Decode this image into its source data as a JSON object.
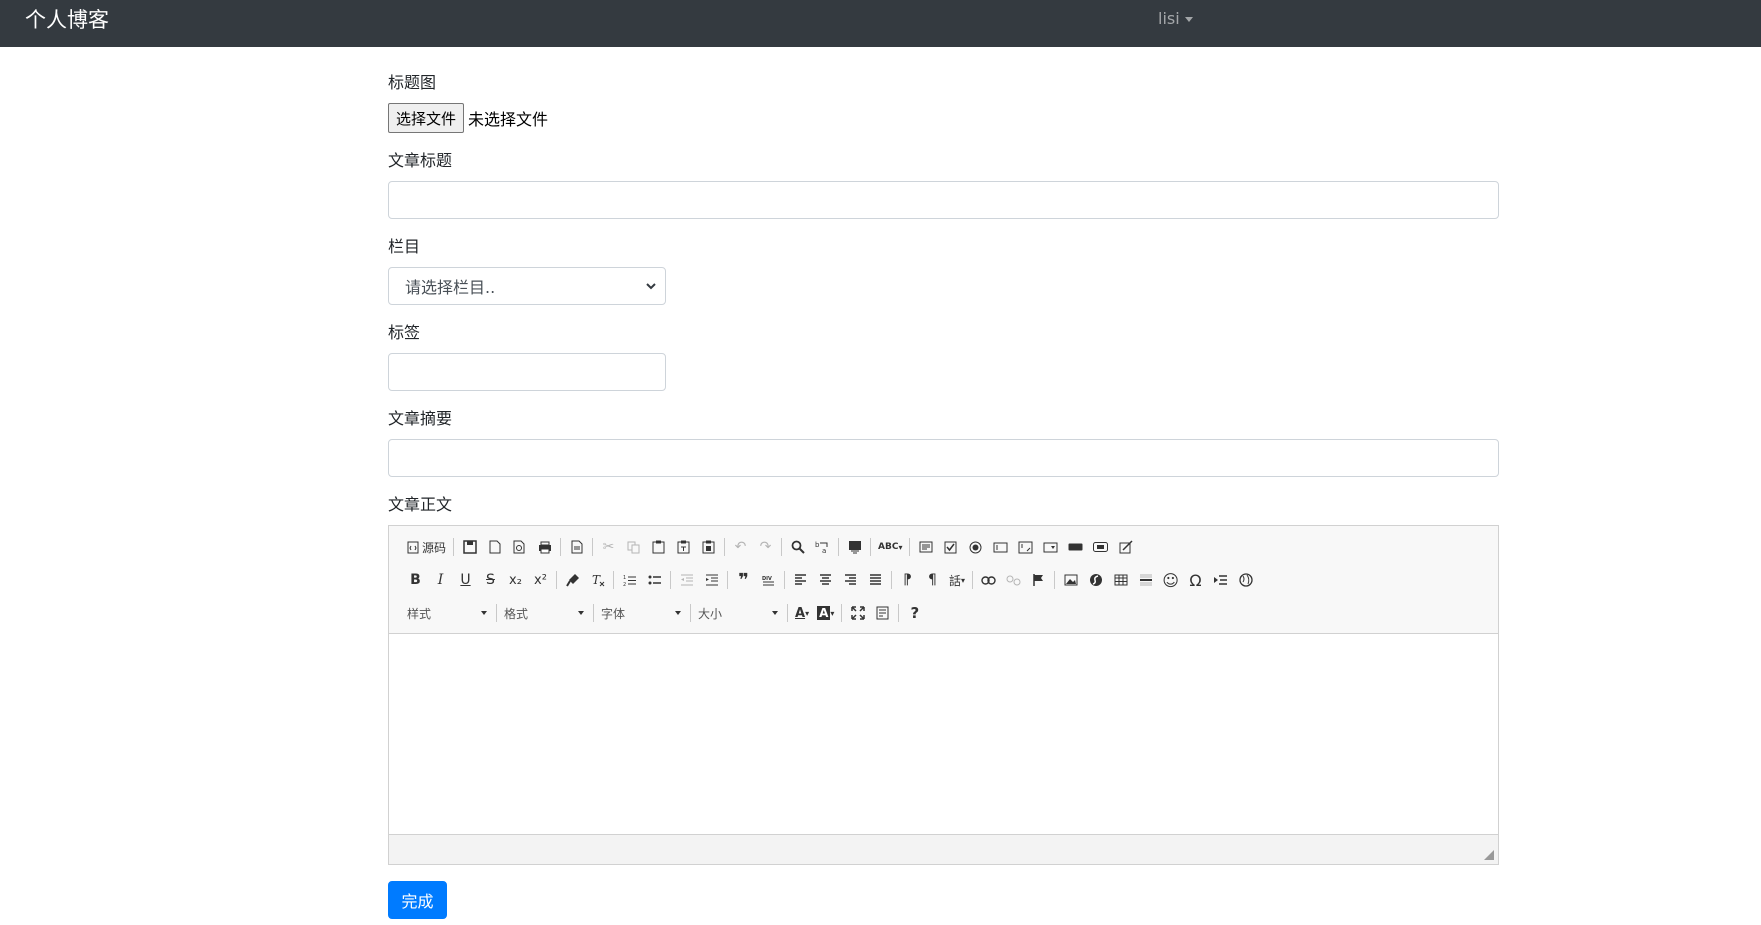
{
  "navbar": {
    "brand": "个人博客",
    "user": "lisi"
  },
  "form": {
    "cover_label": "标题图",
    "file_button": "选择文件",
    "file_status": "未选择文件",
    "title_label": "文章标题",
    "title_value": "",
    "category_label": "栏目",
    "category_selected": "请选择栏目..",
    "tags_label": "标签",
    "tags_value": "",
    "summary_label": "文章摘要",
    "summary_value": "",
    "body_label": "文章正文",
    "submit_label": "完成"
  },
  "editor": {
    "source_label": "源码",
    "combos": {
      "styles": "样式",
      "format": "格式",
      "font": "字体",
      "size": "大小"
    },
    "glyphs": {
      "bold": "B",
      "italic": "I",
      "underline": "U",
      "strike": "S",
      "sub": "x₂",
      "sup": "x²",
      "quote": "❞",
      "omega": "Ω",
      "help": "?",
      "textcolor": "A",
      "bgcolor": "A"
    }
  }
}
